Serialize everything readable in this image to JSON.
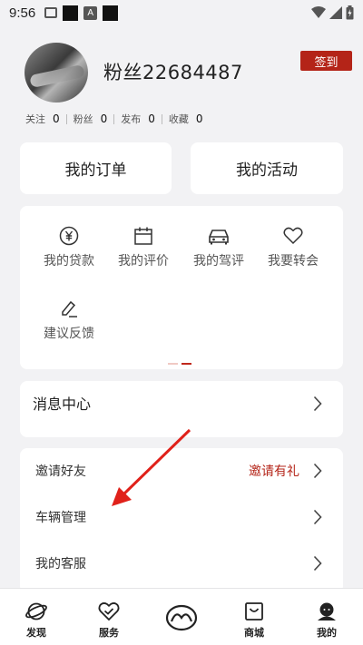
{
  "status_bar": {
    "time": "9:56",
    "a_glyph": "A"
  },
  "profile": {
    "username": "粉丝22684487",
    "checkin_label": "签到",
    "stats": [
      {
        "label": "关注",
        "value": "0"
      },
      {
        "label": "粉丝",
        "value": "0"
      },
      {
        "label": "发布",
        "value": "0"
      },
      {
        "label": "收藏",
        "value": "0"
      }
    ]
  },
  "quick": {
    "orders_label": "我的订单",
    "activities_label": "我的活动"
  },
  "services": {
    "items": [
      {
        "label": "我的贷款",
        "icon": "yen-icon"
      },
      {
        "label": "我的评价",
        "icon": "calendar-icon"
      },
      {
        "label": "我的驾评",
        "icon": "car-icon"
      },
      {
        "label": "我要转会",
        "icon": "heart-icon"
      },
      {
        "label": "建议反馈",
        "icon": "edit-icon"
      }
    ]
  },
  "messages": {
    "label": "消息中心"
  },
  "menu": {
    "invite_label": "邀请好友",
    "invite_extra": "邀请有礼",
    "vehicle_label": "车辆管理",
    "service_label": "我的客服"
  },
  "bottom_nav": {
    "items": [
      {
        "label": "发现",
        "icon": "planet-icon"
      },
      {
        "label": "服务",
        "icon": "heart-check-icon"
      },
      {
        "label": "",
        "icon": "brand-logo-icon"
      },
      {
        "label": "商城",
        "icon": "shop-bag-icon"
      },
      {
        "label": "我的",
        "icon": "profile-icon"
      }
    ]
  },
  "colors": {
    "accent": "#b42418",
    "background": "#f2f2f4",
    "card": "#ffffff",
    "annotation_arrow": "#e0211a"
  }
}
